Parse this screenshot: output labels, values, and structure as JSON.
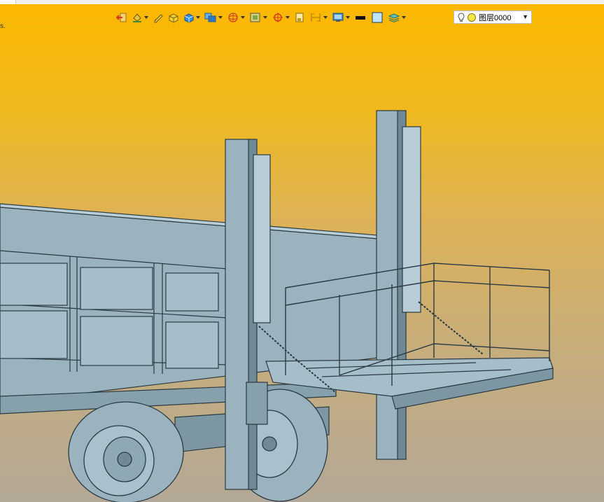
{
  "toolbar": {
    "buttons": [
      {
        "icon": "exit-arrow-icon",
        "dropdown": false
      },
      {
        "icon": "paint-bucket-icon",
        "dropdown": true
      },
      {
        "icon": "pencil-icon",
        "dropdown": false
      },
      {
        "icon": "yellow-box-icon",
        "dropdown": false
      },
      {
        "icon": "blue-cube-icon",
        "dropdown": true
      },
      {
        "icon": "view-display-icon",
        "dropdown": true
      },
      {
        "icon": "wireframe-sphere-icon",
        "dropdown": true
      },
      {
        "icon": "render-mode-icon",
        "dropdown": true
      },
      {
        "icon": "snap-target-icon",
        "dropdown": true
      },
      {
        "icon": "frame-icon",
        "dropdown": false
      },
      {
        "icon": "dimension-icon",
        "dropdown": true
      },
      {
        "icon": "monitor-settings-icon",
        "dropdown": true
      },
      {
        "icon": "line-color-icon",
        "dropdown": false
      },
      {
        "icon": "fill-color-icon",
        "dropdown": false
      },
      {
        "icon": "layers-icon",
        "dropdown": true
      }
    ],
    "layer_select": {
      "label": "图层0000",
      "icons": [
        "lightbulb-icon",
        "sun-icon"
      ]
    }
  },
  "corner_mark": "s.",
  "colors": {
    "model_fill": "#9ab3bf",
    "model_dark": "#6f8a96",
    "model_light": "#b8cdd6",
    "outline": "#2b3a42",
    "bg_top": "#fbb800",
    "bg_bottom": "#b3a897"
  }
}
